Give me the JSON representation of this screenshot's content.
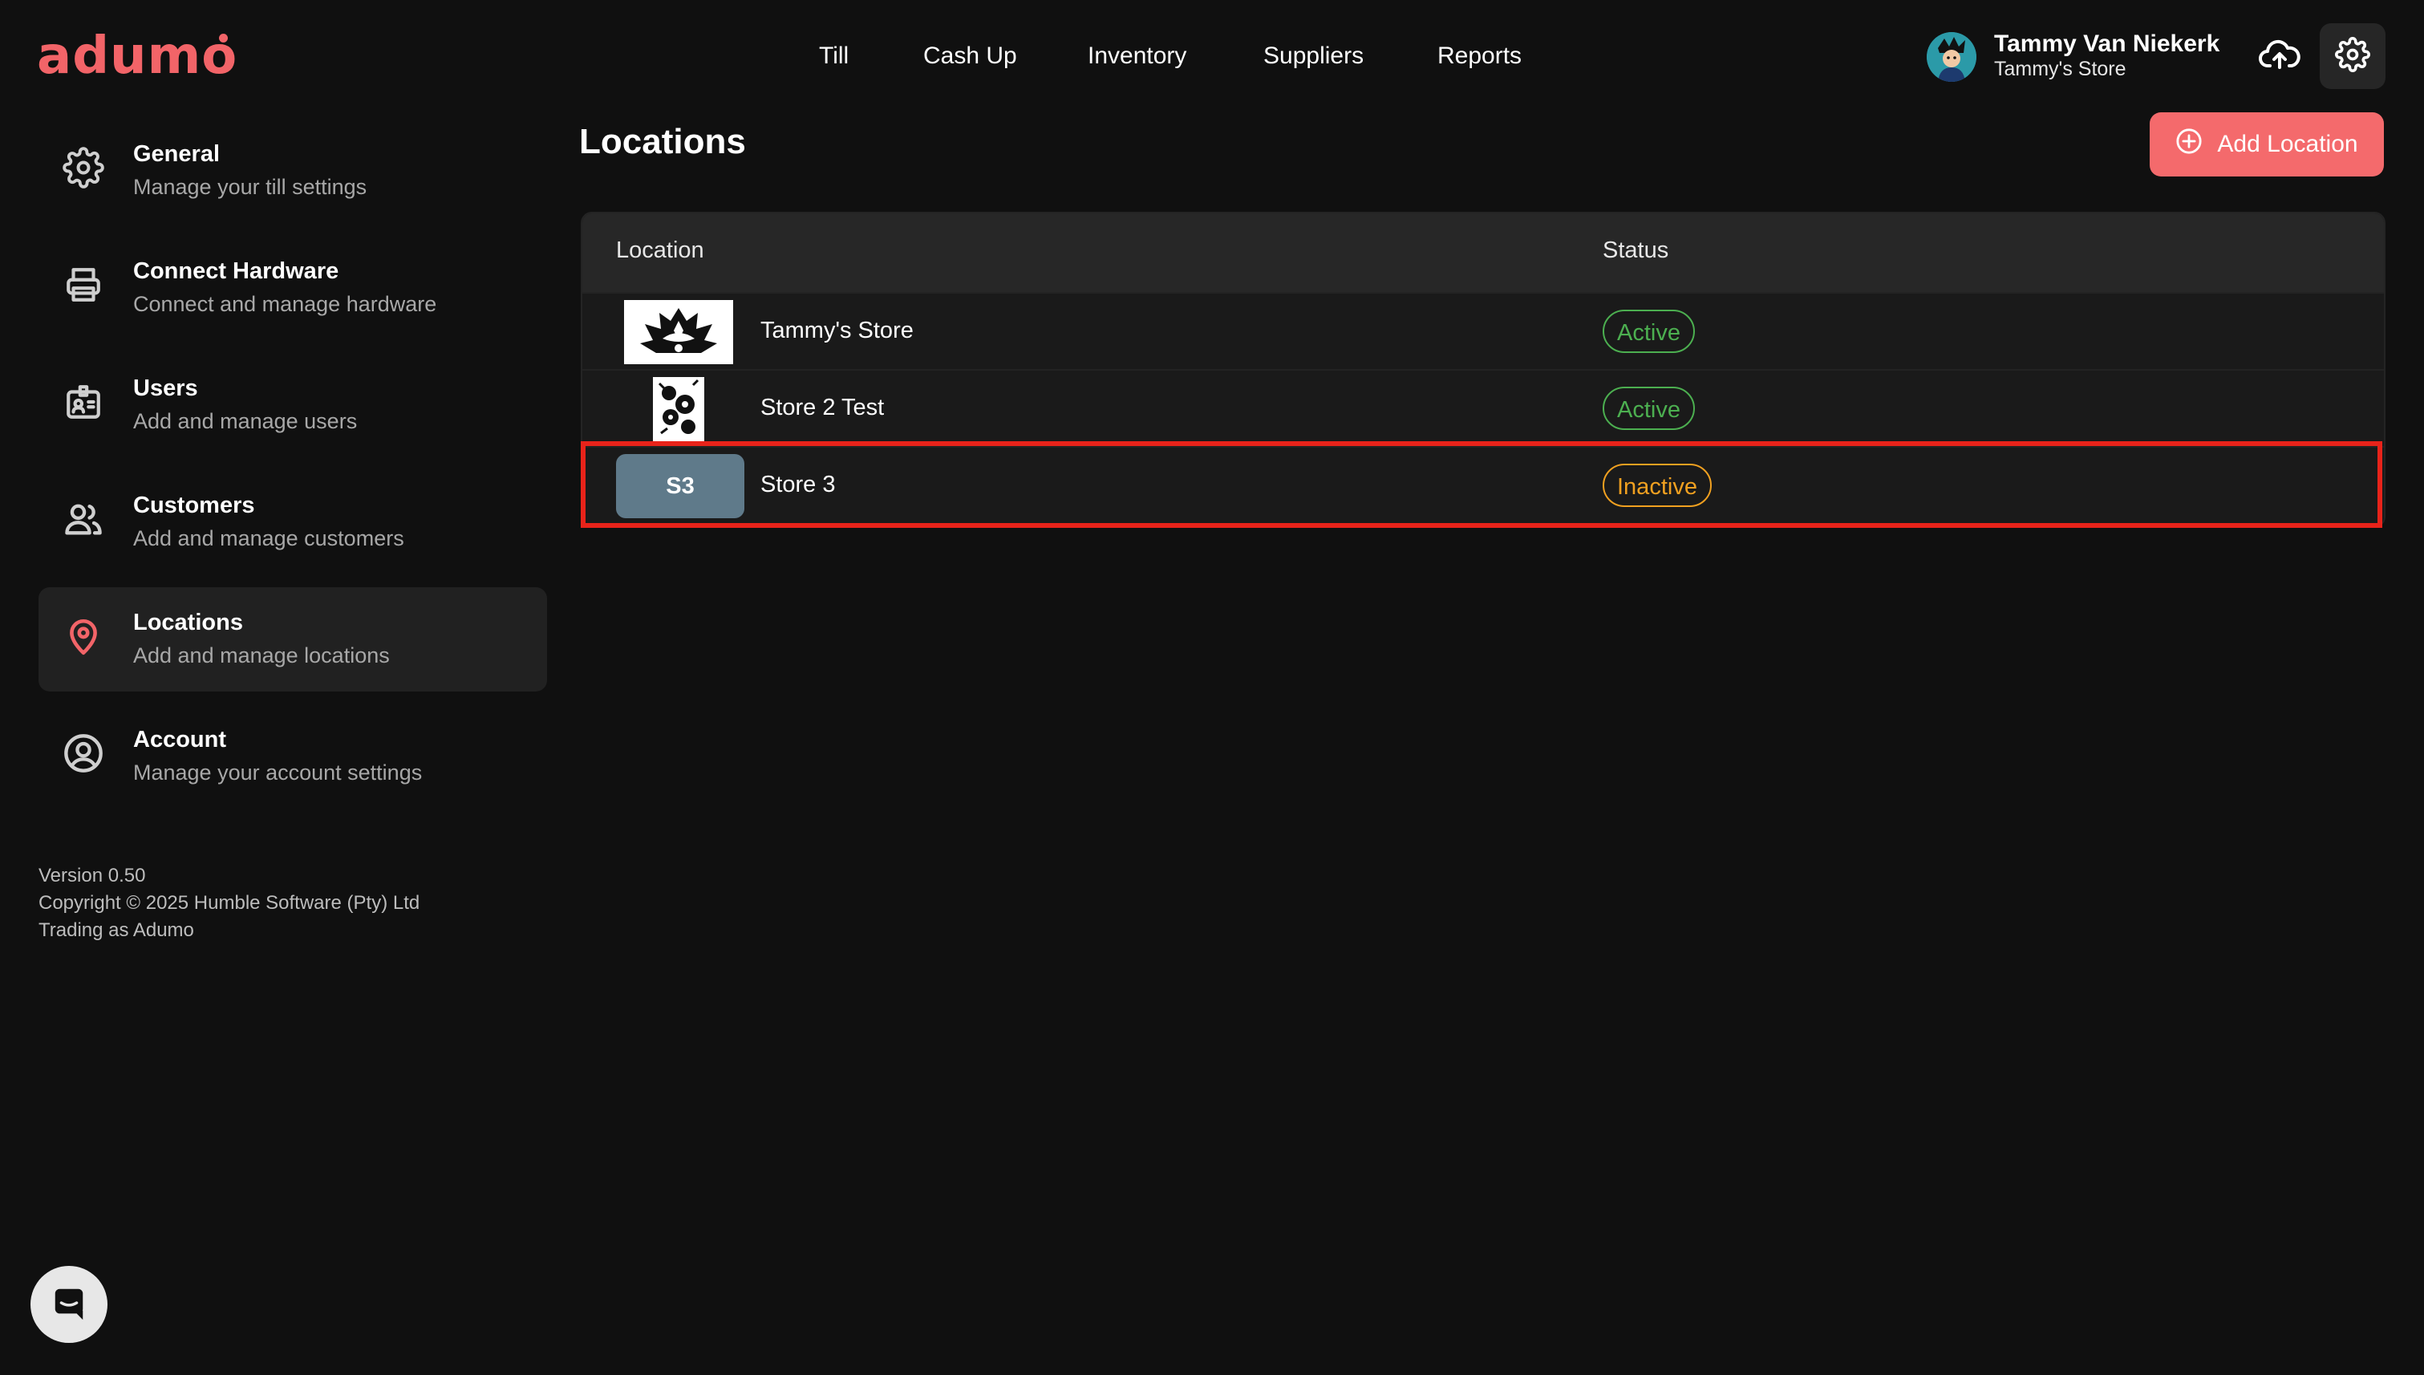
{
  "app": {
    "logo": "adumo"
  },
  "nav": {
    "items": [
      {
        "label": "Till"
      },
      {
        "label": "Cash Up"
      },
      {
        "label": "Inventory"
      },
      {
        "label": "Suppliers"
      },
      {
        "label": "Reports"
      }
    ]
  },
  "user": {
    "name": "Tammy Van Niekerk",
    "store": "Tammy's Store",
    "avatar_icon": "avatar-icon"
  },
  "header_actions": {
    "upload_icon": "cloud-upload-icon",
    "settings_icon": "gear-icon"
  },
  "sidebar": {
    "items": [
      {
        "title": "General",
        "subtitle": "Manage your till settings",
        "icon": "gear-icon"
      },
      {
        "title": "Connect Hardware",
        "subtitle": "Connect and manage hardware",
        "icon": "printer-icon"
      },
      {
        "title": "Users",
        "subtitle": "Add and manage users",
        "icon": "id-badge-icon"
      },
      {
        "title": "Customers",
        "subtitle": "Add and manage customers",
        "icon": "people-icon"
      },
      {
        "title": "Locations",
        "subtitle": "Add and manage locations",
        "icon": "map-pin-icon",
        "active": true
      },
      {
        "title": "Account",
        "subtitle": "Manage your account settings",
        "icon": "user-circle-icon"
      }
    ],
    "footer": {
      "version": "Version 0.50",
      "copyright": "Copyright © 2025 Humble Software (Pty) Ltd",
      "trading": "Trading as Adumo"
    }
  },
  "main": {
    "title": "Locations",
    "add_button_label": "Add Location",
    "table": {
      "columns": [
        "Location",
        "Status"
      ],
      "rows": [
        {
          "name": "Tammy's Store",
          "status": "Active",
          "thumb": "lotus-logo"
        },
        {
          "name": "Store 2 Test",
          "status": "Active",
          "thumb": "floral-image"
        },
        {
          "name": "Store 3",
          "status": "Inactive",
          "thumb": "S3"
        }
      ]
    }
  },
  "colors": {
    "accent": "#f26468",
    "active": "#4caf50",
    "inactive": "#f0a020",
    "highlight": "#e8231a",
    "background": "#101010"
  }
}
